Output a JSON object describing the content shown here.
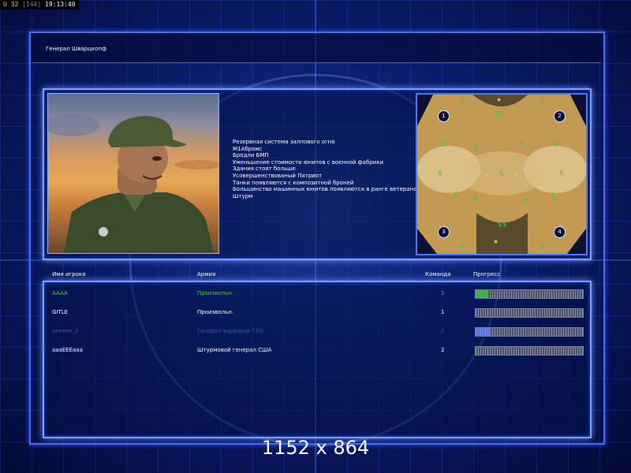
{
  "status_bar": {
    "u_label": "U 32",
    "count": "[144]",
    "time": "19:13:40"
  },
  "title": "Генерал Шварцкопф",
  "features": [
    "Резервная система залпового огня",
    "М1Абрамс",
    "Бредли БМП",
    "Уменьшение стоимости юнитов с военной фабрики",
    "Здания стоят больше",
    "Усовершенствованый Патриот",
    "Танки появляются с композитной броней",
    "Большинство машинных юнитов появляются в ранге ветерана",
    "Штурм"
  ],
  "map": {
    "start_positions": [
      "1",
      "2",
      "3",
      "4"
    ],
    "icons": {
      "supply": "supply-dollar-icon",
      "oil": "oil-derrick-star-icon"
    }
  },
  "table": {
    "headers": {
      "name": "Имя игрока",
      "army": "Армия",
      "team": "Команда",
      "progress": "Прогресс"
    },
    "rows": [
      {
        "name": "AAAA",
        "army": "Произвольн.",
        "team": "1",
        "progress": 0.12,
        "color": "#3cd43c",
        "fill": "#3fc94a"
      },
      {
        "name": "GITLE",
        "army": "Произвольн.",
        "team": "1",
        "progress": 0.0,
        "color": "#ffffff",
        "fill": "#3fc94a"
      },
      {
        "name": "eeeeee_II",
        "army": "Генерал варваров ГЛА",
        "team": "2",
        "progress": 0.14,
        "color": "#3a52a8",
        "fill": "#6b86ff"
      },
      {
        "name": "aaaEEEaaa",
        "army": "Штурмовой генерал США",
        "team": "2",
        "progress": 0.0,
        "color": "#ffffff",
        "fill": "#3fc94a"
      }
    ]
  },
  "resolution_label": "1152 x 864",
  "colors": {
    "frame": "#7ea0ff",
    "background": "#07124a"
  }
}
